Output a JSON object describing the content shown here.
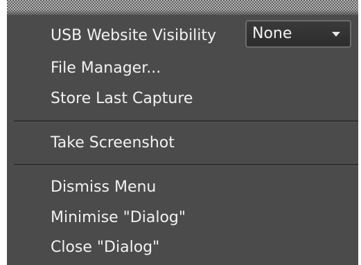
{
  "menu": {
    "usb_visibility_label": "USB Website Visibility",
    "usb_visibility_value": "None",
    "file_manager": "File Manager...",
    "store_last_capture": "Store Last Capture",
    "take_screenshot": "Take Screenshot",
    "dismiss_menu": "Dismiss Menu",
    "minimise_dialog": "Minimise \"Dialog\"",
    "close_dialog": "Close \"Dialog\""
  },
  "icons": {
    "select_caret": "chevron-down-icon"
  },
  "colors": {
    "menu_background": "#4b4b4b",
    "text": "#f2f2f2",
    "select_background": "#2c2c2c"
  }
}
